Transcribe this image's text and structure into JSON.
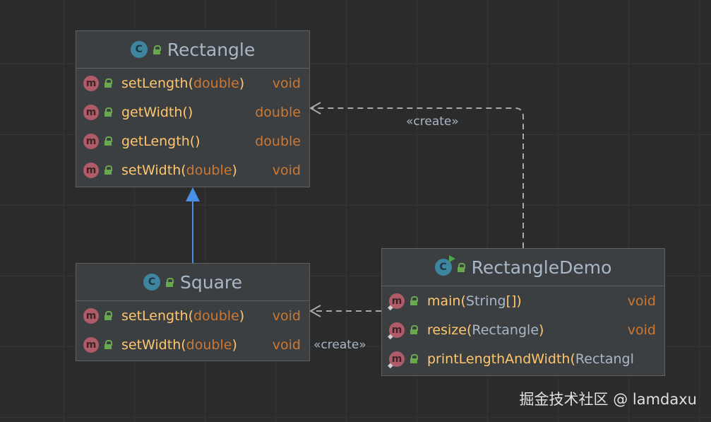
{
  "classes": {
    "rectangle": {
      "name": "Rectangle",
      "icon": "C",
      "members": [
        {
          "name": "setLength",
          "open": "(",
          "param": "double",
          "close": ")",
          "ret": "void"
        },
        {
          "name": "getWidth",
          "open": "(",
          "param": "",
          "close": ")",
          "ret": "double"
        },
        {
          "name": "getLength",
          "open": "(",
          "param": "",
          "close": ")",
          "ret": "double"
        },
        {
          "name": "setWidth",
          "open": "(",
          "param": "double",
          "close": ")",
          "ret": "void"
        }
      ]
    },
    "square": {
      "name": "Square",
      "icon": "C",
      "members": [
        {
          "name": "setLength",
          "open": "(",
          "param": "double",
          "close": ")",
          "ret": "void"
        },
        {
          "name": "setWidth",
          "open": "(",
          "param": "double",
          "close": ")",
          "ret": "void"
        }
      ]
    },
    "demo": {
      "name": "RectangleDemo",
      "icon": "C",
      "members": [
        {
          "name": "main",
          "open": "(",
          "param": "String",
          "close": "[])",
          "ret": "void"
        },
        {
          "name": "resize",
          "open": "(",
          "param": "Rectangle",
          "close": ")",
          "ret": "void"
        },
        {
          "name": "printLengthAndWidth",
          "open": " (",
          "param": "Rectangl",
          "close": "",
          "ret": ""
        }
      ]
    }
  },
  "member_icon": "m",
  "relations": {
    "create_top": "«create»",
    "create_bottom": "«create»"
  },
  "watermark": "掘金技术社区 @ lamdaxu",
  "colors": {
    "background": "#2b2b2b",
    "box": "#3c3f41",
    "method_name": "#ffc66d",
    "keyword": "#cc7832",
    "text": "#a9b7c6",
    "inheritance_arrow": "#4a8fe7"
  }
}
